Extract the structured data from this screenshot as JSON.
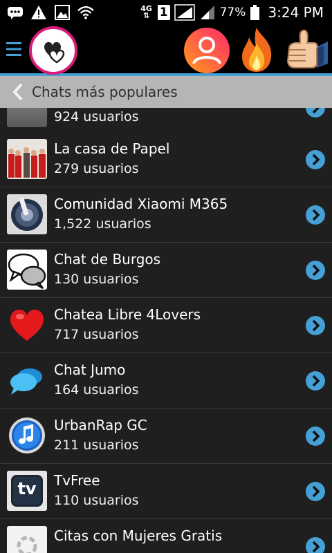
{
  "status_bar": {
    "network": "4G",
    "sim_slot": "1",
    "battery": "77%",
    "time": "3:24 PM"
  },
  "top_bar": {
    "menu_icon": "hamburger-icon",
    "logo_icon": "hearts-logo-icon",
    "actions": [
      "profile-icon",
      "fire-icon",
      "thumbs-up-icon"
    ]
  },
  "subheader": {
    "title": "Chats más populares",
    "back_icon": "back-chevron-icon"
  },
  "colors": {
    "accent": "#45a0d6",
    "logo_ring": "#d81b7a",
    "profile_gradient": [
      "#ff2a6d",
      "#ff9a1c"
    ]
  },
  "chats": [
    {
      "title": "",
      "count": "924 usuarios",
      "icon": "grey-photo"
    },
    {
      "title": "La casa de Papel",
      "count": "279 usuarios",
      "icon": "la-casa-de-papel-photo"
    },
    {
      "title": "Comunidad Xiaomi M365",
      "count": "1,522 usuarios",
      "icon": "scooter-wheel-icon"
    },
    {
      "title": "Chat de Burgos",
      "count": "130 usuarios",
      "icon": "speech-bubbles-icon"
    },
    {
      "title": "Chatea Libre 4Lovers",
      "count": "717 usuarios",
      "icon": "red-heart-icon"
    },
    {
      "title": "Chat Jumo",
      "count": "164 usuarios",
      "icon": "blue-chat-bubbles-icon"
    },
    {
      "title": "UrbanRap GC",
      "count": "211 usuarios",
      "icon": "music-note-icon"
    },
    {
      "title": "TvFree",
      "count": "110 usuarios",
      "icon": "tv-logo-icon"
    },
    {
      "title": "Citas con Mujeres Gratis",
      "count": "",
      "icon": "loading-ring-icon"
    }
  ]
}
